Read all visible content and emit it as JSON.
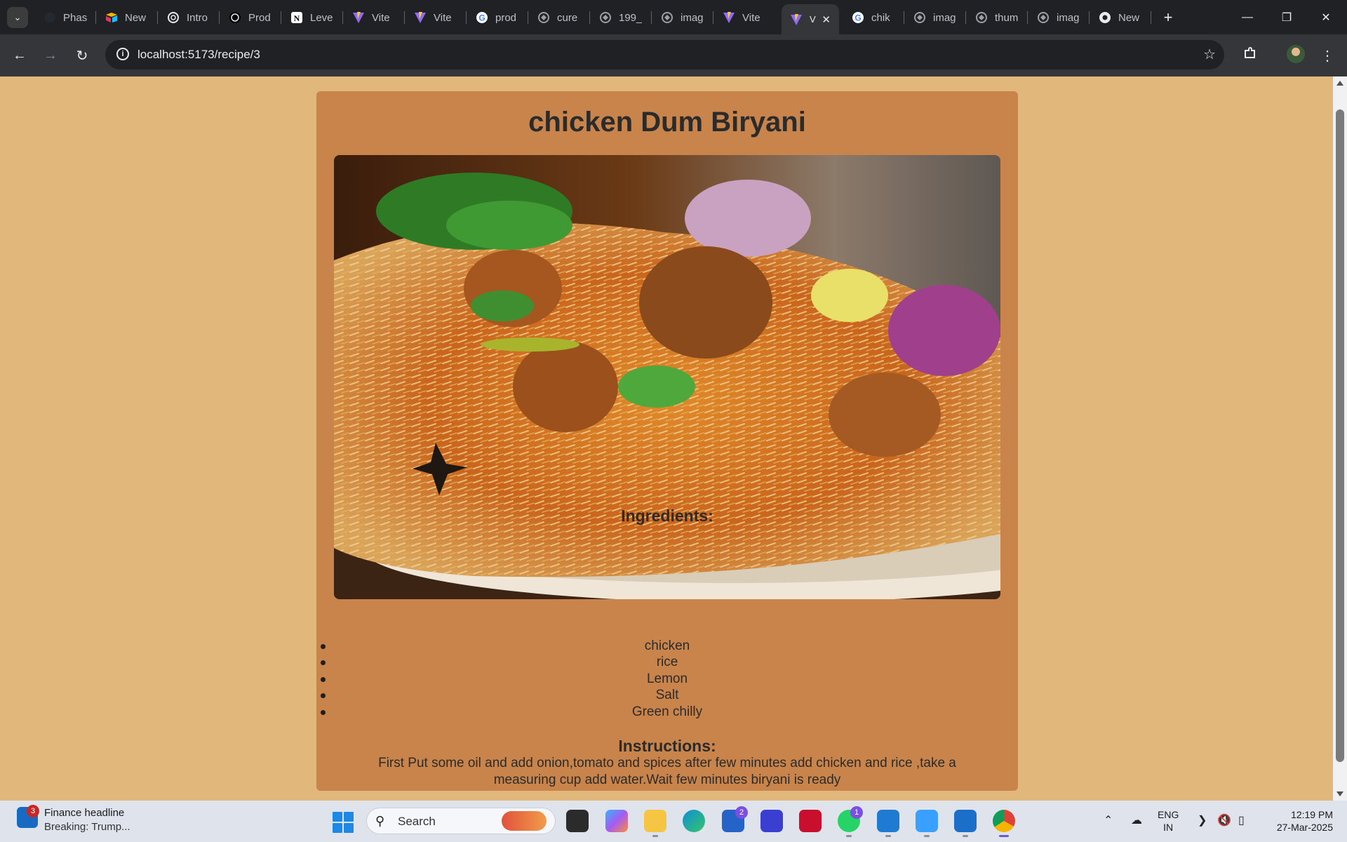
{
  "browser": {
    "tabs": [
      {
        "title": "Phas",
        "icon": "github-icon"
      },
      {
        "title": "New",
        "icon": "airtable-icon"
      },
      {
        "title": "Intro",
        "icon": "openai-icon"
      },
      {
        "title": "Prod",
        "icon": "openai-icon"
      },
      {
        "title": "Leve",
        "icon": "notion-icon"
      },
      {
        "title": "Vite",
        "icon": "vite-icon"
      },
      {
        "title": "Vite",
        "icon": "vite-icon"
      },
      {
        "title": "prod",
        "icon": "google-icon"
      },
      {
        "title": "cure",
        "icon": "globe-icon"
      },
      {
        "title": "199_",
        "icon": "globe-icon"
      },
      {
        "title": "imag",
        "icon": "globe-icon"
      },
      {
        "title": "Vite",
        "icon": "vite-icon"
      },
      {
        "title": "V",
        "icon": "vite-icon",
        "active": true
      },
      {
        "title": "chik",
        "icon": "google-icon"
      },
      {
        "title": "imag",
        "icon": "globe-icon"
      },
      {
        "title": "thum",
        "icon": "globe-icon"
      },
      {
        "title": "imag",
        "icon": "globe-icon"
      },
      {
        "title": "New",
        "icon": "chrome-icon"
      }
    ],
    "url": "localhost:5173/recipe/3"
  },
  "recipe": {
    "title": "chicken Dum Biryani",
    "ingredients_heading": "Ingredients:",
    "ingredients": [
      "chicken",
      "rice",
      "Lemon",
      "Salt",
      "Green chilly"
    ],
    "instructions_heading": "Instructions:",
    "instructions": "First Put some oil and add onion,tomato and spices after few minutes add chicken and rice ,take a measuring cup add water.Wait few minutes biryani is ready"
  },
  "taskbar": {
    "news_badge": "3",
    "news_title": "Finance headline",
    "news_subtitle": "Breaking: Trump...",
    "search_label": "Search",
    "store_badge": "2",
    "whatsapp_badge": "1",
    "lang_line1": "ENG",
    "lang_line2": "IN",
    "time": "12:19 PM",
    "date": "27-Mar-2025"
  },
  "colors": {
    "page_bg": "#e2b77b",
    "card_bg": "#c8844b",
    "chrome_dark": "#202124",
    "chrome_toolbar": "#35363a"
  }
}
